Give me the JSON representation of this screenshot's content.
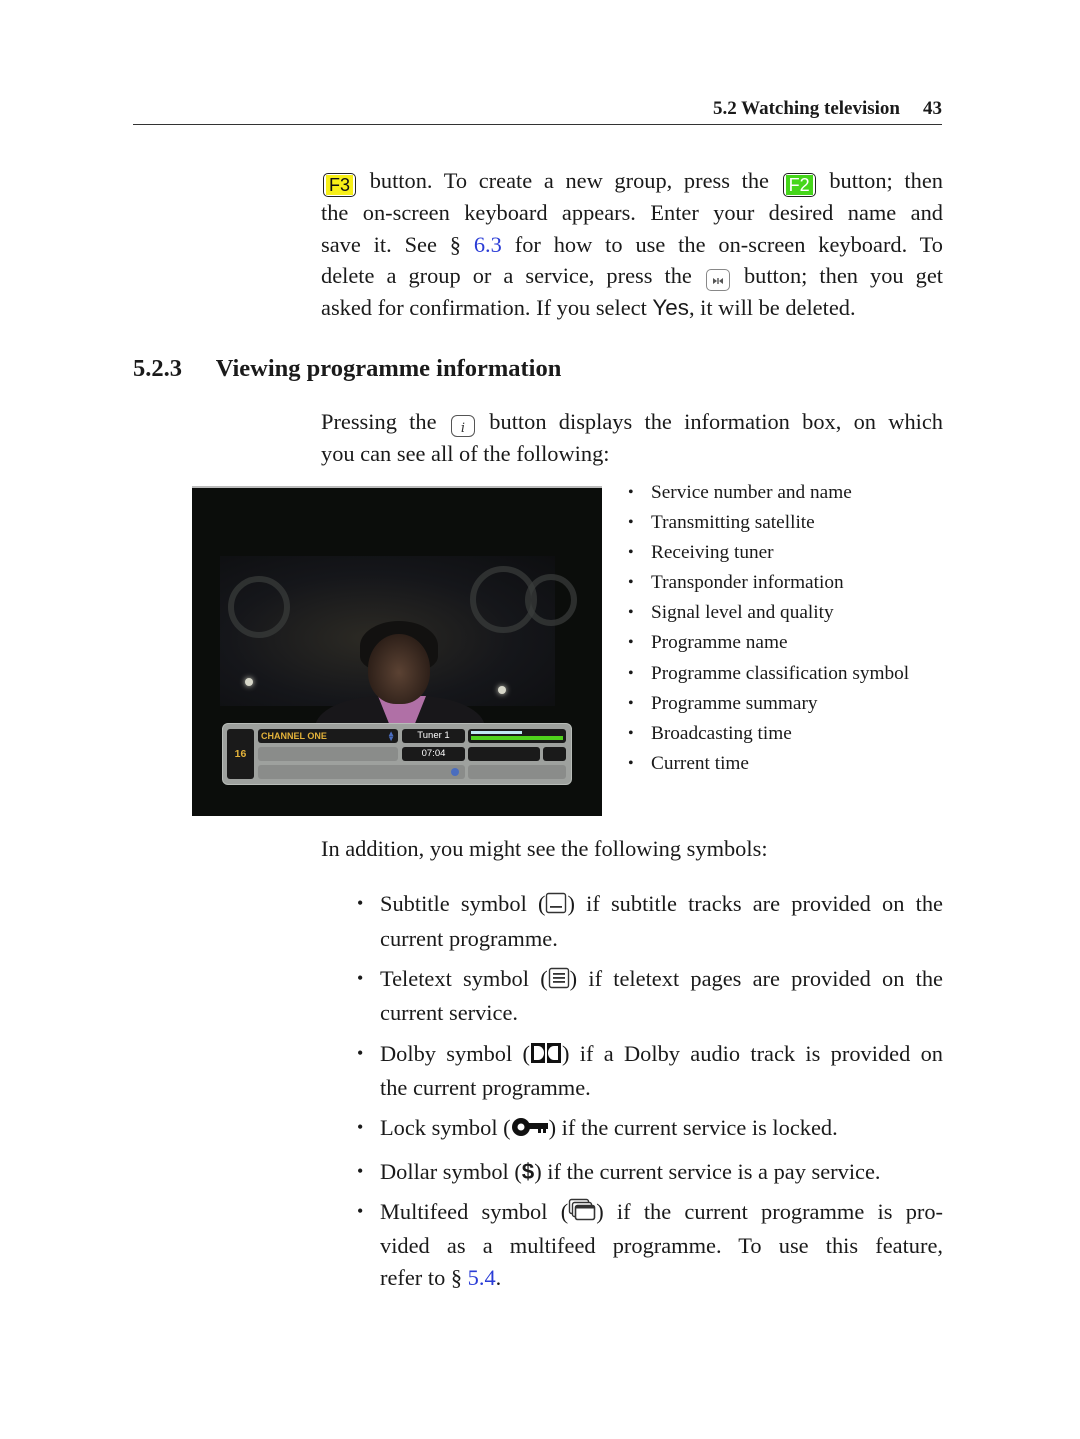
{
  "header": {
    "section_title": "5.2 Watching television",
    "page_number": "43"
  },
  "intro_paragraph": {
    "key_f3": "F3",
    "line1_a": "button. To create a new group, press the",
    "key_f2": "F2",
    "line1_b": "button; then",
    "line2": "the on-screen keyboard appears. Enter your desired name and",
    "line3_a": "save it. See §",
    "line3_link": "6.3",
    "line3_b": "for how to use the on-screen keyboard. To",
    "line4_a": "delete a group or a service, press the",
    "key_delete_glyph": "⏭",
    "line4_b": "button; then you get",
    "line5_a": "asked for confirmation. If you select",
    "line5_yes": "Yes",
    "line5_b": ", it will be deleted."
  },
  "section": {
    "number": "5.2.3",
    "title": "Viewing programme information"
  },
  "info_paragraph": {
    "line1_a": "Pressing the",
    "key_info": "i",
    "line1_b": "button displays the information box, on which",
    "line2": "you can see all of the following:"
  },
  "tv_screenshot": {
    "service_number": "16",
    "channel_name": "CHANNEL ONE",
    "tuner": "Tuner 1",
    "current_time": "07:04",
    "signal_level": 0.55,
    "signal_quality": 1.0,
    "colors": {
      "osd_text": "#e3b23a",
      "signal_bar": "#bfe9f4",
      "quality_bar": "#4fd21c"
    }
  },
  "info_items": [
    "Service number and name",
    "Transmitting satellite",
    "Receiving tuner",
    "Transponder information",
    "Signal level and quality",
    "Programme name",
    "Programme classification symbol",
    "Programme summary",
    "Broadcasting time",
    "Current time"
  ],
  "symbols_intro": "In addition, you might see the following symbols:",
  "symbols": [
    {
      "icon": "subtitle-icon",
      "line1_a": "Subtitle symbol (",
      "line1_b": ") if subtitle tracks are provided on the",
      "line2": "current programme."
    },
    {
      "icon": "teletext-icon",
      "line1_a": "Teletext symbol (",
      "line1_b": ") if teletext pages are provided on the",
      "line2": "current service."
    },
    {
      "icon": "dolby-icon",
      "line1_a": "Dolby symbol (",
      "line1_b": ") if a Dolby audio track is provided on",
      "line2": "the current programme."
    },
    {
      "icon": "lock-key-icon",
      "line1_a": "Lock symbol (",
      "line1_b": ") if the current service is locked."
    },
    {
      "icon": "dollar-icon",
      "glyph": "$",
      "line1_a": "Dollar symbol (",
      "line1_b": ") if the current service is a pay service."
    },
    {
      "icon": "multifeed-icon",
      "line1_a": "Multifeed symbol (",
      "line1_b": ") if the current programme is pro-",
      "line2": "vided as a multifeed programme. To use this feature,",
      "line3_a": "refer to §",
      "line3_link": "5.4",
      "line3_b": "."
    }
  ],
  "colors": {
    "link": "#2a3cd6",
    "key_f3": "#f7ef18",
    "key_f2": "#45d61a"
  }
}
